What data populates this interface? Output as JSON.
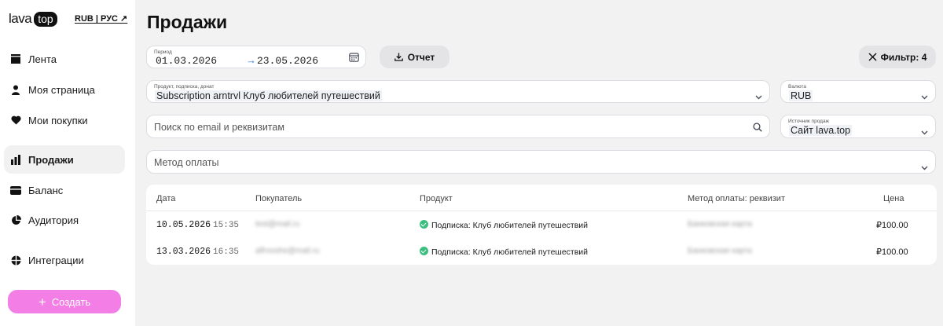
{
  "brand": {
    "word": "lava",
    "pill": "top"
  },
  "locale": "RUB | РУС ↗",
  "nav": [
    {
      "label": "Лента",
      "icon": "feed-icon"
    },
    {
      "label": "Моя страница",
      "icon": "user-icon"
    },
    {
      "label": "Мои покупки",
      "icon": "heart-icon"
    },
    {
      "label": "Продажи",
      "icon": "bar-chart-icon",
      "active": true
    },
    {
      "label": "Баланс",
      "icon": "wallet-icon"
    },
    {
      "label": "Аудитория",
      "icon": "pie-chart-icon"
    },
    {
      "label": "Интеграции",
      "icon": "integrations-icon"
    }
  ],
  "create_label": "Создать",
  "page_title": "Продажи",
  "period": {
    "label": "Период",
    "from": "01.03.2026",
    "arrow": "→",
    "to": "23.05.2026"
  },
  "report_label": "Отчет",
  "filter_label": "Фильтр: 4",
  "product_filter": {
    "label": "Продукт, подписка, донат",
    "value": "Subscription arntrvl Клуб любителей путешествий"
  },
  "currency_filter": {
    "label": "Валюта",
    "value": "RUB"
  },
  "search": {
    "placeholder": "Поиск по email и реквизитам"
  },
  "source_filter": {
    "label": "Источник продаж",
    "value": "Сайт lava.top"
  },
  "payment_method": {
    "placeholder": "Метод оплаты"
  },
  "table": {
    "headers": {
      "date": "Дата",
      "buyer": "Покупатель",
      "product": "Продукт",
      "method": "Метод оплаты: реквизит",
      "price": "Цена"
    },
    "rows": [
      {
        "date": "10.05.2026",
        "time": "15:35",
        "buyer": "test@mail.ru",
        "product": "Подписка: Клуб любителей путешествий",
        "method": "Банковская карта",
        "price": "₽100.00"
      },
      {
        "date": "13.03.2026",
        "time": "16:35",
        "buyer": "alfrooshe@mail.ru",
        "product": "Подписка: Клуб любителей путешествий",
        "method": "Банковская карта",
        "price": "₽100.00"
      }
    ]
  },
  "colors": {
    "accent_pink": "#f27ee6",
    "success_green": "#3bbf7f"
  }
}
